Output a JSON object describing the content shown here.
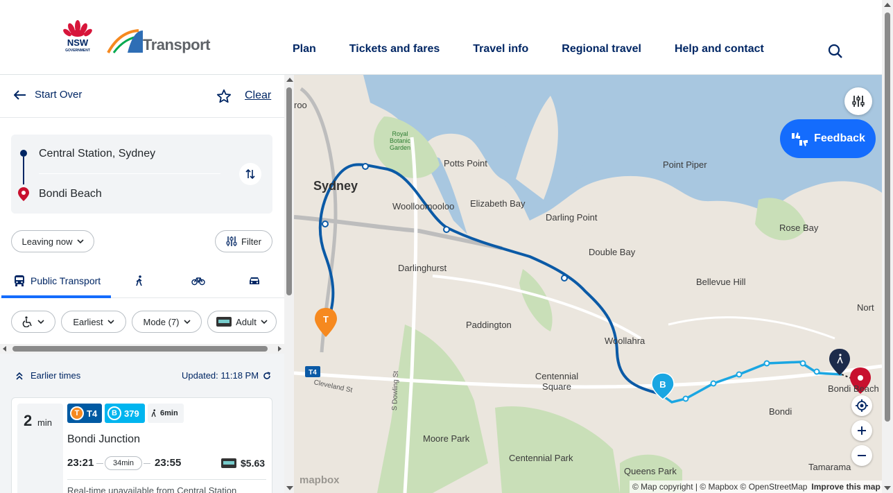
{
  "header": {
    "nsw_logo_text": "NSW",
    "nsw_logo_sub": "GOVERNMENT",
    "transport_logo_text": "Transport",
    "nav": [
      "Plan",
      "Tickets and fares",
      "Travel info",
      "Regional travel",
      "Help and contact"
    ]
  },
  "planner": {
    "start_over": "Start Over",
    "clear": "Clear",
    "origin": "Central Station, Sydney",
    "destination": "Bondi Beach",
    "leaving": "Leaving now",
    "filter": "Filter",
    "tabs": {
      "public_transport": "Public Transport"
    },
    "chips": {
      "earliest": "Earliest",
      "mode": "Mode (7)",
      "adult": "Adult"
    },
    "earlier_times": "Earlier times",
    "updated": "Updated: 11:18 PM"
  },
  "trip": {
    "minutes": "2",
    "minutes_unit": "min",
    "train_line": "T4",
    "train_letter": "T",
    "bus_route": "379",
    "bus_letter": "B",
    "walk": "6min",
    "destination": "Bondi Junction",
    "depart": "23:21",
    "duration": "34min",
    "arrive": "23:55",
    "fare": "$5.63",
    "note": "Real-time unavailable from Central Station"
  },
  "map": {
    "feedback": "Feedback",
    "labels": {
      "sydney": "Sydney",
      "royal_botanic": "Royal Botanic Garden",
      "potts_point": "Potts Point",
      "woolloomooloo": "Woolloomooloo",
      "elizabeth_bay": "Elizabeth Bay",
      "darling_point": "Darling Point",
      "point_piper": "Point Piper",
      "rose_bay": "Rose Bay",
      "double_bay": "Double Bay",
      "darlinghurst": "Darlinghurst",
      "bellevue_hill": "Bellevue Hill",
      "paddington": "Paddington",
      "woollahra": "Woollahra",
      "centennial_square": "Centennial Square",
      "bondi_beach": "Bondi Beach",
      "bondi": "Bondi",
      "moore_park": "Moore Park",
      "centennial_park": "Centennial Park",
      "queens_park": "Queens Park",
      "tamarama": "Tamarama",
      "cleveland_st": "Cleveland St",
      "s_dowling_st": "S Dowling St",
      "north": "Nort",
      "roo": "roo",
      "t4_marker": "T4",
      "train_marker": "T",
      "bus_marker": "B"
    },
    "attribution": "© Map copyright | © Mapbox © OpenStreetMap",
    "improve": "Improve this map",
    "mapbox": "mapbox",
    "route_train_color": "#0b5aa6",
    "route_bus_color": "#1aa6e2",
    "destination_pin_color": "#c8102e"
  }
}
